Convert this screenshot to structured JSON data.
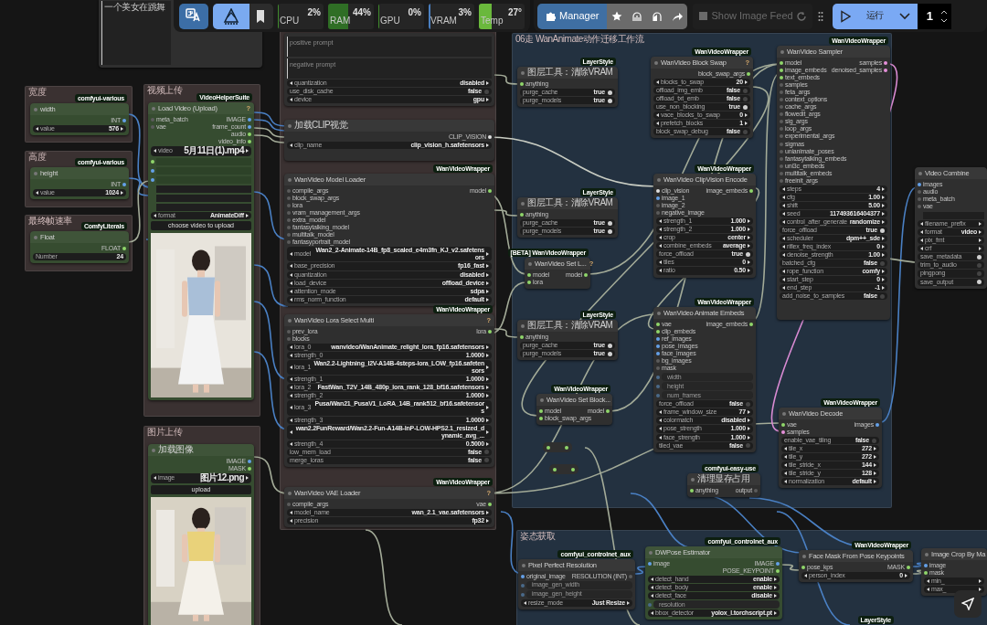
{
  "toolbar": {
    "tools": [
      {
        "kind": "translate"
      },
      {
        "kind": "logo"
      },
      {
        "kind": "bookmark"
      }
    ],
    "meters": [
      {
        "label": "CPU",
        "reading": "2%",
        "level": 0.02,
        "color": "#3f8a2c"
      },
      {
        "label": "RAM",
        "reading": "44%",
        "level": 0.44,
        "color": "#2f6e25"
      },
      {
        "label": "GPU",
        "reading": "0%",
        "level": 0,
        "color": "#3f8a2c"
      },
      {
        "label": "VRAM",
        "reading": "3%",
        "level": 0.03,
        "color": "#4a7fc0"
      },
      {
        "label": "Temp",
        "reading": "27°",
        "level": 0.27,
        "color": "#6ab83c"
      }
    ],
    "manager": "Manager",
    "actions": [
      {
        "kind": "star"
      },
      {
        "kind": "arch"
      },
      {
        "kind": "arch-half"
      },
      {
        "kind": "share"
      }
    ],
    "feed": {
      "label": "Show Image Feed",
      "disabled": true
    },
    "run": "运行",
    "queue": "1"
  },
  "groups": [
    {
      "title": "宽度",
      "color": "#3a3131"
    },
    {
      "title": "高度",
      "color": "#3a3131"
    },
    {
      "title": "最终帧速率",
      "color": "#3a3131"
    },
    {
      "title": "视频上传",
      "color": "#3a3131"
    },
    {
      "title": "图片上传",
      "color": "#3a3131"
    },
    {
      "color": "#3a3131"
    },
    {
      "title": "06走 WanAnimate动作迁移工作流",
      "color": "#233140"
    },
    {
      "title": "姿态获取",
      "color": "#233140"
    }
  ],
  "nodes": [
    {
      "kind": "node",
      "rows": [
        {
          "kind": "text",
          "value": "一个美女在跳舞"
        }
      ]
    },
    {
      "kind": "node",
      "title": "width",
      "tag": "comfyui-various",
      "color": "#364c30",
      "rows": [
        {
          "kind": "port",
          "out": {
            "label": "INT",
            "color": "#64a0e8"
          }
        },
        {
          "kind": "combo",
          "label": "value",
          "value": "576"
        }
      ]
    },
    {
      "kind": "node",
      "title": "height",
      "tag": "comfyui-various",
      "color": "#364c30",
      "rows": [
        {
          "kind": "port",
          "out": {
            "label": "INT",
            "color": "#64a0e8"
          }
        },
        {
          "kind": "combo",
          "label": "value",
          "value": "1024"
        }
      ]
    },
    {
      "kind": "node",
      "title": "Float",
      "tag": "ComfyLiterals",
      "color": "#364c30",
      "rows": [
        {
          "kind": "port",
          "out": {
            "label": "FLOAT",
            "color": "#8fd66a"
          }
        },
        {
          "kind": "field",
          "label": "Number",
          "value": "24"
        }
      ]
    },
    {
      "kind": "node",
      "title": "Load Video (Upload)",
      "tag": "VideoHelperSuite",
      "color": "#364c30",
      "help": "?",
      "rows": [
        {
          "kind": "port",
          "in": {
            "label": "meta_batch"
          },
          "out": {
            "label": "IMAGE",
            "color": "#64a0e8"
          }
        },
        {
          "kind": "port",
          "in": {
            "label": "vae"
          },
          "out": {
            "label": "frame_count",
            "color": "#64a0e8"
          }
        },
        {
          "kind": "port",
          "out": {
            "label": "audio",
            "color": "#8fd66a"
          }
        },
        {
          "kind": "port",
          "out": {
            "label": "video_info",
            "color": "#8fd66a"
          }
        },
        {
          "kind": "combo",
          "label": "video",
          "value": "5月11日(1).mp4"
        },
        {
          "kind": "blank",
          "color": "#8fd66a"
        },
        {
          "kind": "blank",
          "color": "#64a0e8"
        },
        {
          "kind": "blank",
          "color": "#64a0e8"
        },
        {
          "kind": "blank"
        },
        {
          "kind": "blank"
        },
        {
          "kind": "blank"
        },
        {
          "kind": "combo",
          "label": "format",
          "value": "AnimateDiff"
        },
        {
          "kind": "button",
          "label": "choose video to upload"
        },
        {
          "kind": "picture"
        }
      ]
    },
    {
      "kind": "node",
      "title": "加载图像",
      "color": "#364c30",
      "rows": [
        {
          "kind": "port",
          "out": {
            "label": "IMAGE",
            "color": "#64a0e8"
          }
        },
        {
          "kind": "port",
          "out": {
            "label": "MASK",
            "color": "#8fd66a"
          }
        },
        {
          "kind": "combo",
          "label": "image",
          "value": "图片12.png"
        },
        {
          "kind": "button",
          "label": "upload"
        },
        {
          "kind": "picture"
        }
      ]
    },
    {
      "kind": "node",
      "rows": [
        {
          "kind": "text",
          "placeholder": "positive prompt"
        },
        {
          "kind": "text",
          "placeholder": "negative prompt"
        },
        {
          "kind": "combo",
          "label": "quantization",
          "value": "disabled"
        },
        {
          "kind": "toggle",
          "label": "use_disk_cache",
          "value": "false",
          "on": false
        },
        {
          "kind": "combo",
          "label": "device",
          "value": "gpu"
        }
      ]
    },
    {
      "kind": "node",
      "title": "加载CLIP视觉",
      "rows": [
        {
          "kind": "port",
          "out": {
            "label": "CLIP_VISION",
            "color": "#e0e0e0"
          }
        },
        {
          "kind": "combo",
          "label": "clip_name",
          "value": "clip_vision_h.safetensors"
        }
      ]
    },
    {
      "kind": "node",
      "title": "WanVideo Model Loader",
      "tag": "WanVideoWrapper",
      "rows": [
        {
          "kind": "port",
          "in": {
            "label": "compile_args"
          },
          "out": {
            "label": "model",
            "color": "#8fd66a"
          }
        },
        {
          "kind": "port",
          "in": {
            "label": "block_swap_args"
          }
        },
        {
          "kind": "port",
          "in": {
            "label": "lora"
          }
        },
        {
          "kind": "port",
          "in": {
            "label": "vram_management_args"
          }
        },
        {
          "kind": "port",
          "in": {
            "label": "extra_model"
          }
        },
        {
          "kind": "port",
          "in": {
            "label": "fantasytalking_model"
          }
        },
        {
          "kind": "port",
          "in": {
            "label": "multitalk_model"
          }
        },
        {
          "kind": "port",
          "in": {
            "label": "fantasyportrait_model"
          }
        },
        {
          "kind": "combo",
          "label": "model",
          "value": "Wan2_2-Animate-14B_fp8_scaled_e4m3fn_KJ_v2.safetensors"
        },
        {
          "kind": "combo",
          "label": "base_precision",
          "value": "fp16_fast"
        },
        {
          "kind": "combo",
          "label": "quantization",
          "value": "disabled"
        },
        {
          "kind": "combo",
          "label": "load_device",
          "value": "offload_device"
        },
        {
          "kind": "combo",
          "label": "attention_mode",
          "value": "sdpa"
        },
        {
          "kind": "combo",
          "label": "rms_norm_function",
          "value": "default"
        }
      ]
    },
    {
      "kind": "node",
      "title": "WanVideo Lora Select Multi",
      "tag": "WanVideoWrapper",
      "help": "?",
      "rows": [
        {
          "kind": "port",
          "in": {
            "label": "prev_lora"
          },
          "out": {
            "label": "lora",
            "color": "#8fd66a"
          }
        },
        {
          "kind": "port",
          "in": {
            "label": "blocks"
          }
        },
        {
          "kind": "combo",
          "label": "lora_0",
          "value": "wanvideo/WanAnimate_relight_lora_fp16.safetensors"
        },
        {
          "kind": "combo",
          "label": "strength_0",
          "value": "1.0000"
        },
        {
          "kind": "combo",
          "label": "lora_1",
          "value": "Wan2.2-Lightning_I2V-A14B-4steps-lora_LOW_fp16.safetensors"
        },
        {
          "kind": "combo",
          "label": "strength_1",
          "value": "1.0000"
        },
        {
          "kind": "combo",
          "label": "lora_2",
          "value": "FastWan_T2V_14B_480p_lora_rank_128_bf16.safetensors"
        },
        {
          "kind": "combo",
          "label": "strength_2",
          "value": "1.0000"
        },
        {
          "kind": "combo",
          "label": "lora_3",
          "value": "Pusa/Wan21_PusaV1_LoRA_14B_rank512_bf16.safetensors"
        },
        {
          "kind": "combo",
          "label": "strength_3",
          "value": "1.0000"
        },
        {
          "kind": "combo",
          "value": "wan2.2FunReward/Wan2.2-Fun-A14B-InP-LOW-HPS2.1_resized_dynamic_avg_..."
        },
        {
          "kind": "combo",
          "label": "strength_4",
          "value": "0.5000"
        },
        {
          "kind": "toggle",
          "label": "low_mem_load",
          "value": "false",
          "on": false
        },
        {
          "kind": "toggle",
          "label": "merge_loras",
          "value": "false",
          "on": false
        }
      ]
    },
    {
      "kind": "node",
      "title": "WanVideo VAE Loader",
      "tag": "WanVideoWrapper",
      "help": "?",
      "rows": [
        {
          "kind": "port",
          "in": {
            "label": "compile_args"
          },
          "out": {
            "label": "vae",
            "color": "#8fd66a"
          }
        },
        {
          "kind": "combo",
          "label": "model_name",
          "value": "wan_2.1_vae.safetensors"
        },
        {
          "kind": "combo",
          "label": "precision",
          "value": "fp32"
        }
      ]
    },
    {
      "kind": "node",
      "title": "图层工具：清除VRAM",
      "tag": "LayerStyle",
      "rows": [
        {
          "kind": "port",
          "in": {
            "label": "anything",
            "color": "#8fd66a"
          }
        },
        {
          "kind": "toggle",
          "label": "purge_cache",
          "value": "true",
          "on": true
        },
        {
          "kind": "toggle",
          "label": "purge_models",
          "value": "true",
          "on": true
        }
      ]
    },
    {
      "kind": "node",
      "title": "图层工具：清除VRAM",
      "tag": "LayerStyle",
      "rows": [
        {
          "kind": "port",
          "in": {
            "label": "anything",
            "color": "#8fd66a"
          }
        },
        {
          "kind": "toggle",
          "label": "purge_cache",
          "value": "true",
          "on": true
        },
        {
          "kind": "toggle",
          "label": "purge_models",
          "value": "true",
          "on": true
        }
      ]
    },
    {
      "kind": "node",
      "title": "WanVideo Set L...",
      "tag": "[BETA] WanVideoWrapper",
      "help": "?",
      "rows": [
        {
          "kind": "port",
          "in": {
            "label": "model",
            "color": "#8fd66a"
          },
          "out": {
            "label": "model",
            "color": "#8fd66a"
          }
        },
        {
          "kind": "port",
          "in": {
            "label": "lora",
            "color": "#8fd66a"
          }
        }
      ]
    },
    {
      "kind": "node",
      "title": "图层工具：清除VRAM",
      "tag": "LayerStyle",
      "rows": [
        {
          "kind": "port",
          "in": {
            "label": "anything",
            "color": "#8fd66a"
          }
        },
        {
          "kind": "toggle",
          "label": "purge_cache",
          "value": "true",
          "on": true
        },
        {
          "kind": "toggle",
          "label": "purge_models",
          "value": "true",
          "on": true
        }
      ]
    },
    {
      "kind": "node",
      "title": "WanVideo Block Swap",
      "tag": "WanVideoWrapper",
      "help": "?",
      "rows": [
        {
          "kind": "port",
          "out": {
            "label": "block_swap_args",
            "color": "#8fd66a"
          }
        },
        {
          "kind": "combo",
          "label": "blocks_to_swap",
          "value": "20"
        },
        {
          "kind": "toggle",
          "label": "offload_img_emb",
          "value": "false",
          "on": false
        },
        {
          "kind": "toggle",
          "label": "offload_txt_emb",
          "value": "false",
          "on": false
        },
        {
          "kind": "toggle",
          "label": "use_non_blocking",
          "value": "true",
          "on": true
        },
        {
          "kind": "combo",
          "label": "vace_blocks_to_swap",
          "value": "0"
        },
        {
          "kind": "combo",
          "label": "prefetch_blocks",
          "value": "1"
        },
        {
          "kind": "toggle",
          "label": "block_swap_debug",
          "value": "false",
          "on": false
        }
      ]
    },
    {
      "kind": "node",
      "title": "WanVideo ClipVision Encode",
      "tag": "WanVideoWrapper",
      "rows": [
        {
          "kind": "port",
          "in": {
            "label": "clip_vision",
            "color": "#e0e0e0"
          },
          "out": {
            "label": "image_embeds",
            "color": "#8fd66a"
          }
        },
        {
          "kind": "port",
          "in": {
            "label": "image_1",
            "color": "#64a0e8"
          }
        },
        {
          "kind": "port",
          "in": {
            "label": "image_2"
          }
        },
        {
          "kind": "port",
          "in": {
            "label": "negative_image"
          }
        },
        {
          "kind": "combo",
          "label": "strength_1",
          "value": "1.000"
        },
        {
          "kind": "combo",
          "label": "strength_2",
          "value": "1.000"
        },
        {
          "kind": "combo",
          "label": "crop",
          "value": "center"
        },
        {
          "kind": "combo",
          "label": "combine_embeds",
          "value": "average"
        },
        {
          "kind": "toggle",
          "label": "force_offload",
          "value": "true",
          "on": true
        },
        {
          "kind": "combo",
          "label": "tiles",
          "value": "0"
        },
        {
          "kind": "combo",
          "label": "ratio",
          "value": "0.50"
        }
      ]
    },
    {
      "kind": "node",
      "title": "WanVideo Sampler",
      "tag": "WanVideoWrapper",
      "rows": [
        {
          "kind": "port",
          "in": {
            "label": "model",
            "color": "#8fd66a"
          },
          "out": {
            "label": "samples",
            "color": "#e58fd9"
          }
        },
        {
          "kind": "port",
          "in": {
            "label": "image_embeds",
            "color": "#8fd66a"
          },
          "out": {
            "label": "denoised_samples",
            "color": "#e58fd9"
          }
        },
        {
          "kind": "port",
          "in": {
            "label": "text_embeds",
            "color": "#8fd66a"
          }
        },
        {
          "kind": "port",
          "in": {
            "label": "samples"
          }
        },
        {
          "kind": "port",
          "in": {
            "label": "feta_args"
          }
        },
        {
          "kind": "port",
          "in": {
            "label": "context_options"
          }
        },
        {
          "kind": "port",
          "in": {
            "label": "cache_args"
          }
        },
        {
          "kind": "port",
          "in": {
            "label": "flowedit_args"
          }
        },
        {
          "kind": "port",
          "in": {
            "label": "slg_args"
          }
        },
        {
          "kind": "port",
          "in": {
            "label": "loop_args"
          }
        },
        {
          "kind": "port",
          "in": {
            "label": "experimental_args"
          }
        },
        {
          "kind": "port",
          "in": {
            "label": "sigmas"
          }
        },
        {
          "kind": "port",
          "in": {
            "label": "unianimate_poses"
          }
        },
        {
          "kind": "port",
          "in": {
            "label": "fantasytalking_embeds"
          }
        },
        {
          "kind": "port",
          "in": {
            "label": "uni3c_embeds"
          }
        },
        {
          "kind": "port",
          "in": {
            "label": "multitalk_embeds"
          }
        },
        {
          "kind": "port",
          "in": {
            "label": "freeinit_args"
          }
        },
        {
          "kind": "combo",
          "label": "steps",
          "value": "4"
        },
        {
          "kind": "combo",
          "label": "cfg",
          "value": "1.00"
        },
        {
          "kind": "combo",
          "label": "shift",
          "value": "5.00"
        },
        {
          "kind": "combo",
          "label": "seed",
          "value": "117493616404377"
        },
        {
          "kind": "combo",
          "label": "control_after_generate",
          "value": "randomize"
        },
        {
          "kind": "toggle",
          "label": "force_offload",
          "value": "true",
          "on": true
        },
        {
          "kind": "combo",
          "label": "scheduler",
          "value": "dpm++_sde"
        },
        {
          "kind": "combo",
          "label": "riflex_freq_index",
          "value": "0"
        },
        {
          "kind": "combo",
          "label": "denoise_strength",
          "value": "1.00"
        },
        {
          "kind": "toggle",
          "label": "batched_cfg",
          "value": "false",
          "on": false
        },
        {
          "kind": "combo",
          "label": "rope_function",
          "value": "comfy"
        },
        {
          "kind": "combo",
          "label": "start_step",
          "value": "0"
        },
        {
          "kind": "combo",
          "label": "end_step",
          "value": "-1"
        },
        {
          "kind": "toggle",
          "label": "add_noise_to_samples",
          "value": "false",
          "on": false
        }
      ]
    },
    {
      "kind": "node",
      "title": "WanVideo Animate Embeds",
      "tag": "WanVideoWrapper",
      "rows": [
        {
          "kind": "port",
          "in": {
            "label": "vae",
            "color": "#8fd66a"
          },
          "out": {
            "label": "image_embeds",
            "color": "#8fd66a"
          }
        },
        {
          "kind": "port",
          "in": {
            "label": "clip_embeds",
            "color": "#8fd66a"
          }
        },
        {
          "kind": "port",
          "in": {
            "label": "ref_images",
            "color": "#64a0e8"
          }
        },
        {
          "kind": "port",
          "in": {
            "label": "pose_images",
            "color": "#64a0e8"
          }
        },
        {
          "kind": "port",
          "in": {
            "label": "face_images",
            "color": "#64a0e8"
          }
        },
        {
          "kind": "port",
          "in": {
            "label": "bg_images"
          }
        },
        {
          "kind": "port",
          "in": {
            "label": "mask"
          }
        },
        {
          "kind": "slot",
          "label": "width"
        },
        {
          "kind": "slot",
          "label": "height"
        },
        {
          "kind": "slot",
          "label": "num_frames"
        },
        {
          "kind": "toggle",
          "label": "force_offload",
          "value": "false",
          "on": false
        },
        {
          "kind": "combo",
          "label": "frame_window_size",
          "value": "77"
        },
        {
          "kind": "combo",
          "label": "colormatch",
          "value": "disabled"
        },
        {
          "kind": "combo",
          "label": "pose_strength",
          "value": "1.000"
        },
        {
          "kind": "combo",
          "label": "face_strength",
          "value": "1.000"
        },
        {
          "kind": "toggle",
          "label": "tiled_vae",
          "value": "false",
          "on": false
        }
      ]
    },
    {
      "kind": "node",
      "title": "WanVideo Set Block...",
      "tag": "WanVideoWrapper",
      "rows": [
        {
          "kind": "port",
          "in": {
            "label": "model",
            "color": "#8fd66a"
          },
          "out": {
            "label": "model",
            "color": "#8fd66a"
          }
        },
        {
          "kind": "port",
          "in": {
            "label": "block_swap_args",
            "color": "#8fd66a"
          }
        }
      ]
    },
    {
      "kind": "reroute"
    },
    {
      "kind": "reroute"
    },
    {
      "kind": "node",
      "title": "清理显存占用",
      "tag": "comfyui-easy-use",
      "rows": [
        {
          "kind": "port",
          "in": {
            "label": "anything",
            "color": "#8fd66a"
          },
          "out": {
            "label": "output"
          }
        }
      ]
    },
    {
      "kind": "node",
      "title": "WanVideo Decode",
      "tag": "WanVideoWrapper",
      "rows": [
        {
          "kind": "port",
          "in": {
            "label": "vae",
            "color": "#8fd66a"
          },
          "out": {
            "label": "images",
            "color": "#64a0e8"
          }
        },
        {
          "kind": "port",
          "in": {
            "label": "samples",
            "color": "#e58fd9"
          }
        },
        {
          "kind": "toggle",
          "label": "enable_vae_tiling",
          "value": "false",
          "on": false
        },
        {
          "kind": "combo",
          "label": "tile_x",
          "value": "272"
        },
        {
          "kind": "combo",
          "label": "tile_y",
          "value": "272"
        },
        {
          "kind": "combo",
          "label": "tile_stride_x",
          "value": "144"
        },
        {
          "kind": "combo",
          "label": "tile_stride_y",
          "value": "128"
        },
        {
          "kind": "combo",
          "label": "normalization",
          "value": "default"
        }
      ]
    },
    {
      "kind": "node",
      "title": "Video Combine",
      "rows": [
        {
          "kind": "port",
          "in": {
            "label": "images",
            "color": "#64a0e8"
          }
        },
        {
          "kind": "port",
          "in": {
            "label": "audio"
          }
        },
        {
          "kind": "port",
          "in": {
            "label": "meta_batch"
          }
        },
        {
          "kind": "port",
          "in": {
            "label": "vae"
          }
        },
        {
          "kind": "blank"
        },
        {
          "kind": "combo",
          "label": "filename_prefix"
        },
        {
          "kind": "combo",
          "label": "format",
          "value": "video"
        },
        {
          "kind": "combo",
          "label": "pix_fmt"
        },
        {
          "kind": "combo",
          "label": "crf"
        },
        {
          "kind": "toggle",
          "label": "save_metadata",
          "on": true
        },
        {
          "kind": "toggle",
          "label": "trim_to_audio",
          "on": false
        },
        {
          "kind": "toggle",
          "label": "pingpong",
          "on": false
        },
        {
          "kind": "toggle",
          "label": "save_output",
          "on": true
        }
      ]
    },
    {
      "kind": "node",
      "title": "Pixel Perfect Resolution",
      "tag": "comfyui_controlnet_aux",
      "rows": [
        {
          "kind": "port",
          "in": {
            "label": "original_image",
            "color": "#64a0e8"
          },
          "out": {
            "label": "RESOLUTION (INT)"
          }
        },
        {
          "kind": "slot",
          "label": "image_gen_width"
        },
        {
          "kind": "slot",
          "label": "image_gen_height"
        },
        {
          "kind": "combo",
          "label": "resize_mode",
          "value": "Just Resize"
        }
      ]
    },
    {
      "kind": "node",
      "title": "DWPose Estimator",
      "tag": "comfyui_controlnet_aux",
      "color": "#364c30",
      "rows": [
        {
          "kind": "port",
          "in": {
            "label": "image",
            "color": "#64a0e8"
          },
          "out": {
            "label": "IMAGE",
            "color": "#64a0e8"
          }
        },
        {
          "kind": "port",
          "out": {
            "label": "POSE_KEYPOINT",
            "color": "#8fd66a"
          }
        },
        {
          "kind": "combo",
          "label": "detect_hand",
          "value": "enable"
        },
        {
          "kind": "combo",
          "label": "detect_body",
          "value": "enable"
        },
        {
          "kind": "combo",
          "label": "detect_face",
          "value": "disable"
        },
        {
          "kind": "slot",
          "label": "resolution"
        },
        {
          "kind": "combo",
          "label": "bbox_detector",
          "value": "yolox_l.torchscript.pt"
        }
      ]
    },
    {
      "kind": "node",
      "title": "Face Mask From Pose Keypoints",
      "tag": "WanVideoWrapper",
      "rows": [
        {
          "kind": "port",
          "in": {
            "label": "pose_kps",
            "color": "#8fd66a"
          },
          "out": {
            "label": "MASK",
            "color": "#8fd66a"
          }
        },
        {
          "kind": "combo",
          "label": "person_index",
          "value": "0"
        }
      ]
    },
    {
      "kind": "node",
      "title": "Image Crop By Ma",
      "rows": [
        {
          "kind": "port",
          "in": {
            "label": "image",
            "color": "#64a0e8"
          }
        },
        {
          "kind": "port",
          "in": {
            "label": "mask",
            "color": "#8fd66a"
          }
        },
        {
          "kind": "combo",
          "label": "min_"
        },
        {
          "kind": "combo",
          "label": "max_"
        }
      ]
    },
    {
      "kind": "node",
      "tag": "LayerStyle"
    }
  ]
}
